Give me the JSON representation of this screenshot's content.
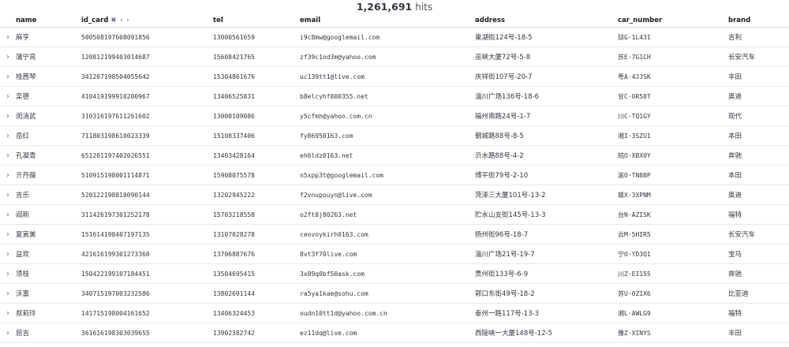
{
  "hits": {
    "count": "1,261,691",
    "label": "hits"
  },
  "columns": {
    "name": "name",
    "id_card": "id_card",
    "id_card_actions": "✖ ‹ ›",
    "tel": "tel",
    "email": "email",
    "address": "address",
    "car_number": "car_number",
    "brand": "brand"
  },
  "expand_icon": "›",
  "rows": [
    {
      "name": "麻亨",
      "id_card": "500508197608091856",
      "tel": "13000561659",
      "email": "i9c8mw@googlemail.com",
      "address": "巢湖街124号-18-5",
      "car_number": "琼G·1L431",
      "brand": "吉利"
    },
    {
      "name": "蒲宁亮",
      "id_card": "120812199403014687",
      "tel": "15608421765",
      "email": "zf39c1nd3m@yahoo.com",
      "address": "巫峡大厦72号-5-8",
      "car_number": "苏E·7G1CH",
      "brand": "长安汽车"
    },
    {
      "name": "桂茜琴",
      "id_card": "341207198504055642",
      "tel": "15304861676",
      "email": "uc139tt1@live.com",
      "address": "庆祥街107号-20-7",
      "car_number": "粤A·4JJSK",
      "brand": "丰田"
    },
    {
      "name": "栾德",
      "id_card": "410419199910200967",
      "tel": "13406525831",
      "email": "b8elcyhf800355.net",
      "address": "淄川广场136号-18-6",
      "car_number": "甘C·OR58T",
      "brand": "奥迪"
    },
    {
      "name": "闵涛武",
      "id_card": "310316197611261602",
      "tel": "13008109086",
      "email": "y5cfmh@yahoo.com.cn",
      "address": "福州南路24号-1-7",
      "car_number": "川C·TQ1GY",
      "brand": "现代"
    },
    {
      "name": "岳红",
      "id_card": "711803198610023339",
      "tel": "15108337406",
      "email": "fy86950163.com",
      "address": "朝城路88号-8-5",
      "car_number": "湘I·3SZU1",
      "brand": "本田"
    },
    {
      "name": "孔凝青",
      "id_card": "651201197402026551",
      "tel": "13403428164",
      "email": "eh6ldz0163.net",
      "address": "沂水路88号-4-2",
      "car_number": "皖O·XBX0Y",
      "brand": "奔驰"
    },
    {
      "name": "亓丹薇",
      "id_card": "510915198001114871",
      "tel": "15908075578",
      "email": "n5xpp3t@googlemail.com",
      "address": "博平街79号-2-10",
      "car_number": "渝O·TN8BP",
      "brand": "本田"
    },
    {
      "name": "吉乐",
      "id_card": "520122198810090144",
      "tel": "13202945222",
      "email": "f2vnupouyn@live.com",
      "address": "菏泽三大厦101号-13-2",
      "car_number": "赣X·3XPNM",
      "brand": "奥迪"
    },
    {
      "name": "阎新",
      "id_card": "311426197301252178",
      "tel": "15703218558",
      "email": "o2ft8j80263.net",
      "address": "贮水山支街145号-13-3",
      "car_number": "台N·AZISK",
      "brand": "福特"
    },
    {
      "name": "夏寅美",
      "id_card": "151614198407197135",
      "tel": "13107028278",
      "email": "ceovoykirh0163.com",
      "address": "扬州街96号-18-7",
      "car_number": "云M·5HIR5",
      "brand": "长安汽车"
    },
    {
      "name": "益欢",
      "id_card": "421616199301273360",
      "tel": "13706887676",
      "email": "8vt3f70live.com",
      "address": "淄川广场21号-19-7",
      "car_number": "宁O·YD3Q1",
      "brand": "宝马"
    },
    {
      "name": "须桂",
      "id_card": "150422199107184451",
      "tel": "13504695415",
      "email": "3x89q0bf50ask.com",
      "address": "贵州街133号-6-9",
      "car_number": "川Z·EI155",
      "brand": "奔驰"
    },
    {
      "name": "沃富",
      "id_card": "340715197003232586",
      "tel": "13802691144",
      "email": "ra5ya1kae@sohu.com",
      "address": "郭口东街49号-18-2",
      "car_number": "苏U·0Z1X6",
      "brand": "比亚迪"
    },
    {
      "name": "叔莉玲",
      "id_card": "141715198004161652",
      "tel": "13406324453",
      "email": "oudn10tt1d@yahoo.com.cn",
      "address": "泰州一路117号-13-3",
      "car_number": "湘L·AWLG9",
      "brand": "福特"
    },
    {
      "name": "屈吉",
      "id_card": "361616198303039655",
      "tel": "13902382742",
      "email": "ez11dq@live.com",
      "address": "西陵峡一大厦148号-12-5",
      "car_number": "豫Z·XINYS",
      "brand": "丰田"
    }
  ]
}
